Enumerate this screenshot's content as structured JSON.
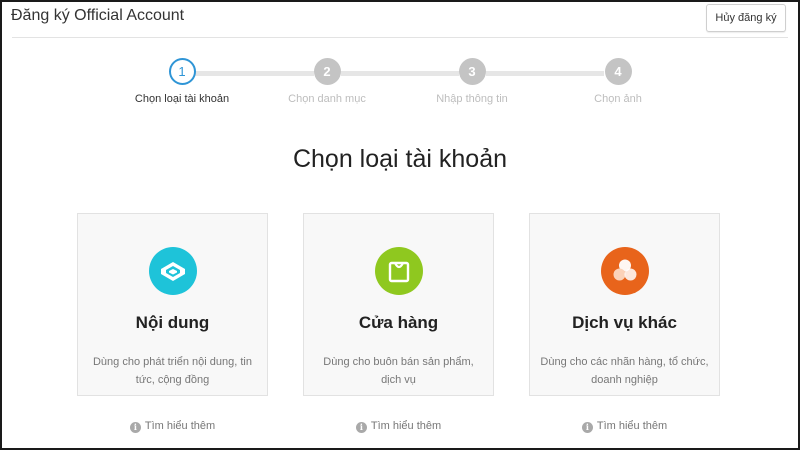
{
  "header": {
    "title": "Đăng ký Official Account",
    "cancel_label": "Hủy đăng ký"
  },
  "steps": [
    {
      "number": "1",
      "label": "Chọn loại tài khoản",
      "active": true
    },
    {
      "number": "2",
      "label": "Chọn danh mục",
      "active": false
    },
    {
      "number": "3",
      "label": "Nhập thông tin",
      "active": false
    },
    {
      "number": "4",
      "label": "Chọn ảnh",
      "active": false
    }
  ],
  "main": {
    "title": "Chọn loại tài khoản"
  },
  "cards": [
    {
      "title": "Nội dung",
      "description": "Dùng cho phát triển nội dung, tin tức, cộng đồng",
      "icon": "content-icon",
      "color": "#1ec3d9",
      "learn_more": "Tìm hiểu thêm"
    },
    {
      "title": "Cửa hàng",
      "description": "Dùng cho buôn bán sản phẩm, dịch vụ",
      "icon": "shopping-bag-icon",
      "color": "#8fc81f",
      "learn_more": "Tìm hiểu thêm"
    },
    {
      "title": "Dịch vụ khác",
      "description": "Dùng cho các nhãn hàng, tổ chức, doanh nghiệp",
      "icon": "services-icon",
      "color": "#e8641b",
      "learn_more": "Tìm hiểu thêm"
    }
  ],
  "colors": {
    "accent": "#2f95d6",
    "inactive_step": "#c4c4c4"
  }
}
